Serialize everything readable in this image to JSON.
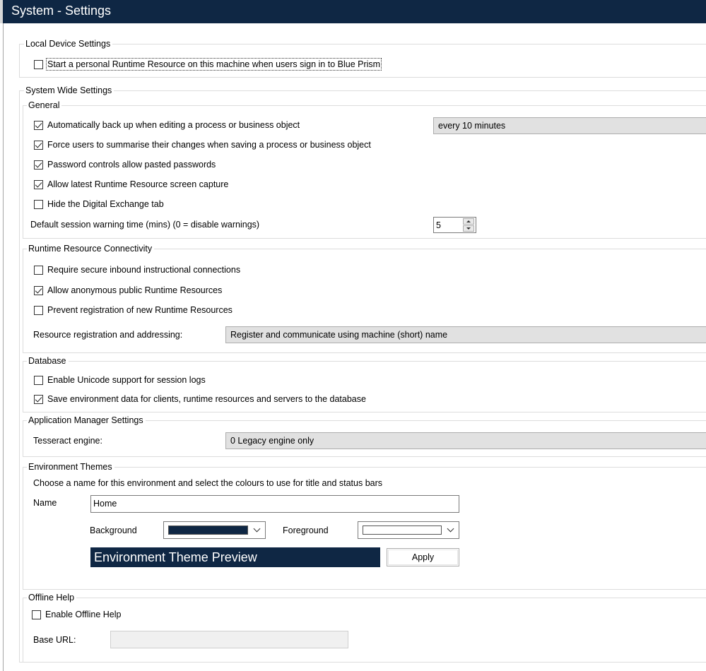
{
  "window": {
    "title": "System - Settings"
  },
  "local_device": {
    "legend": "Local Device Settings",
    "personal_runtime": {
      "label": "Start a personal Runtime Resource on this machine when users sign in to Blue Prism",
      "checked": false
    }
  },
  "system_wide": {
    "legend": "System Wide Settings",
    "general": {
      "legend": "General",
      "auto_backup": {
        "label": "Automatically back up when editing a process or business object",
        "checked": true
      },
      "backup_interval": "every 10 minutes",
      "force_summarise": {
        "label": "Force users to summarise their changes when saving a process or business object",
        "checked": true
      },
      "allow_pasted": {
        "label": "Password controls allow pasted passwords",
        "checked": true
      },
      "allow_capture": {
        "label": "Allow latest Runtime Resource screen capture",
        "checked": true
      },
      "hide_exchange": {
        "label": "Hide the Digital Exchange tab",
        "checked": false
      },
      "warning_label": "Default session warning time (mins) (0 = disable warnings)",
      "warning_value": "5"
    },
    "connectivity": {
      "legend": "Runtime Resource Connectivity",
      "require_secure": {
        "label": "Require secure inbound instructional connections",
        "checked": false
      },
      "allow_anonymous": {
        "label": "Allow anonymous public Runtime Resources",
        "checked": true
      },
      "prevent_registration": {
        "label": "Prevent registration of new Runtime Resources",
        "checked": false
      },
      "addressing_label": "Resource registration and addressing:",
      "addressing_value": "Register and communicate using machine (short) name"
    },
    "database": {
      "legend": "Database",
      "unicode": {
        "label": "Enable Unicode support for session logs",
        "checked": false
      },
      "save_env": {
        "label": "Save environment data for clients, runtime resources and servers to the database",
        "checked": true
      }
    },
    "app_manager": {
      "legend": "Application Manager Settings",
      "tesseract_label": "Tesseract engine:",
      "tesseract_value": "0   Legacy engine only"
    },
    "themes": {
      "legend": "Environment Themes",
      "description": "Choose a name for this environment and select the colours to use for title and status bars",
      "name_label": "Name",
      "name_value": "Home",
      "background_label": "Background",
      "foreground_label": "Foreground",
      "background_color": "#0f2744",
      "foreground_color": "#ffffff",
      "preview_text": "Environment Theme Preview",
      "apply_label": "Apply"
    },
    "offline_help": {
      "legend": "Offline Help",
      "enable": {
        "label": "Enable Offline Help",
        "checked": false
      },
      "base_url_label": "Base URL:",
      "base_url_value": ""
    }
  }
}
